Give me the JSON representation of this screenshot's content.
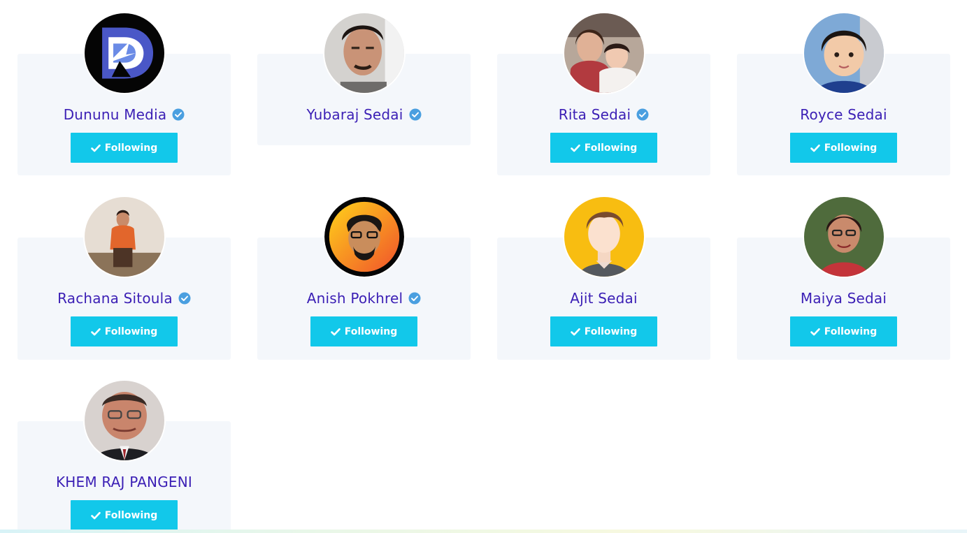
{
  "follow_label": "Following",
  "colors": {
    "accent": "#12c8ea",
    "name": "#3b1fb5",
    "verified": "#4a9fe0",
    "card_bg": "#f4f7fb"
  },
  "users": [
    {
      "name": "Dununu Media",
      "verified": true,
      "show_button": true,
      "avatar": "logo-d-avatar"
    },
    {
      "name": "Yubaraj Sedai",
      "verified": true,
      "show_button": false,
      "avatar": "man-portrait-avatar"
    },
    {
      "name": "Rita Sedai",
      "verified": true,
      "show_button": true,
      "avatar": "mother-child-avatar"
    },
    {
      "name": "Royce Sedai",
      "verified": false,
      "show_button": true,
      "avatar": "boy-portrait-avatar"
    },
    {
      "name": "Rachana Sitoula",
      "verified": true,
      "show_button": true,
      "avatar": "girl-outdoor-avatar"
    },
    {
      "name": "Anish Pokhrel",
      "verified": true,
      "show_button": true,
      "avatar": "illustrated-man-avatar"
    },
    {
      "name": "Ajit Sedai",
      "verified": false,
      "show_button": true,
      "avatar": "default-male-avatar"
    },
    {
      "name": "Maiya Sedai",
      "verified": false,
      "show_button": true,
      "avatar": "woman-portrait-avatar"
    },
    {
      "name": "KHEM RAJ PANGENI",
      "verified": false,
      "show_button": true,
      "avatar": "man-glasses-avatar"
    }
  ]
}
